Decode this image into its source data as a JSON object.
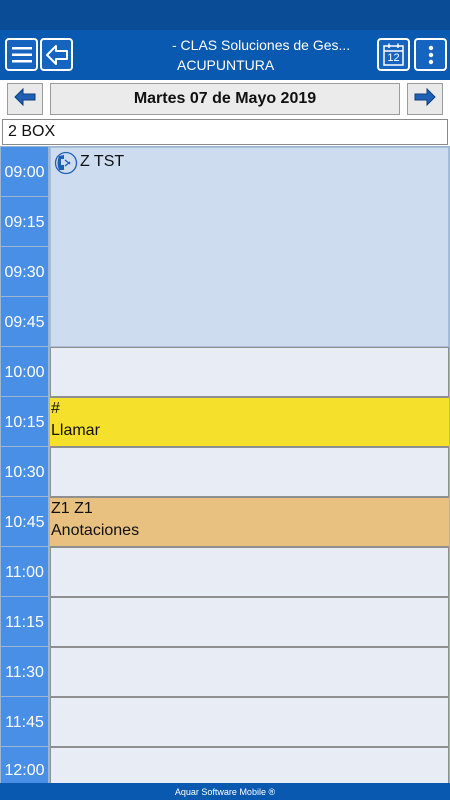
{
  "header": {
    "title_line1": "- CLAS Soluciones de Ges...",
    "title_line2": "ACUPUNTURA",
    "menu_icon": "hamburger-menu-icon",
    "back_icon": "arrow-left-icon",
    "calendar_icon": "calendar-icon",
    "calendar_day": "12",
    "more_icon": "more-vertical-icon"
  },
  "date_nav": {
    "date_label": "Martes 07 de Mayo 2019",
    "prev_icon": "arrow-left-icon",
    "next_icon": "arrow-right-icon"
  },
  "resource": {
    "name": "2 BOX"
  },
  "schedule": {
    "times": [
      "09:00",
      "09:15",
      "09:30",
      "09:45",
      "10:00",
      "10:15",
      "10:30",
      "10:45",
      "11:00",
      "11:15",
      "11:30",
      "11:45",
      "12:00"
    ],
    "appointments": [
      {
        "title": "Z TST",
        "icon": "patient-icon",
        "color": "#cddcee"
      },
      {
        "title": "#",
        "subtitle": "Llamar",
        "color": "#f5e02c"
      },
      {
        "title": "Z1 Z1",
        "subtitle": "Anotaciones",
        "color": "#e8c07f"
      }
    ]
  },
  "footer": {
    "text": "Aquar Software Mobile ®"
  }
}
